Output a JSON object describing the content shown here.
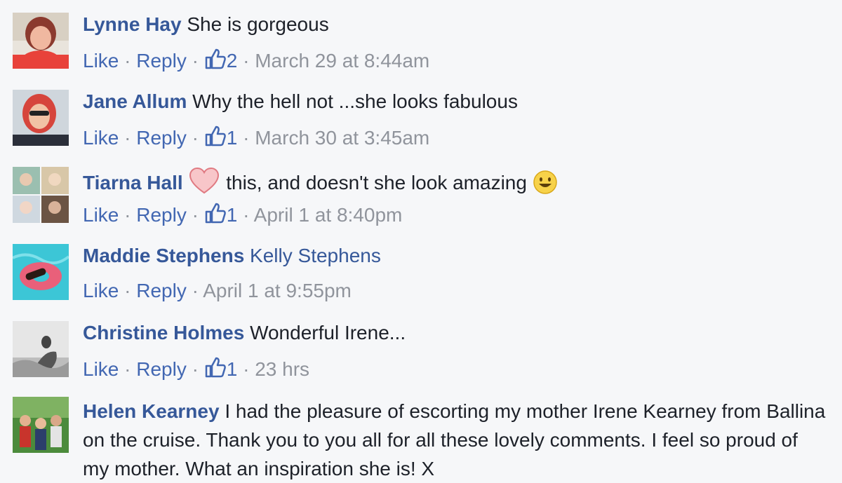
{
  "actions": {
    "like": "Like",
    "reply": "Reply",
    "dot": "·"
  },
  "comments": [
    {
      "name": "Lynne Hay",
      "text": "She is gorgeous",
      "likes": "2",
      "time": "March 29 at 8:44am",
      "avatar_icon": "avatar-photo"
    },
    {
      "name": "Jane Allum",
      "text": "Why the hell not ...she looks fabulous",
      "likes": "1",
      "time": "March 30 at 3:45am",
      "avatar_icon": "avatar-photo"
    },
    {
      "name": "Tiarna Hall",
      "text": "this, and doesn't she look amazing",
      "likes": "1",
      "time": "April 1 at 8:40pm",
      "avatar_icon": "avatar-collage",
      "emoji_before": "heart-icon",
      "emoji_after": "smile-emoji-icon"
    },
    {
      "name": "Maddie Stephens",
      "tagged": "Kelly Stephens",
      "time": "April 1 at 9:55pm",
      "avatar_icon": "avatar-photo"
    },
    {
      "name": "Christine Holmes",
      "text": "Wonderful Irene...",
      "likes": "1",
      "time": "23 hrs",
      "avatar_icon": "avatar-photo"
    },
    {
      "name": "Helen Kearney",
      "text": "I had the pleasure of escorting my mother Irene Kearney from Ballina on the cruise. Thank you to you all for all these lovely comments. I feel so proud of my mother. What an inspiration she is! X",
      "avatar_icon": "avatar-photo"
    }
  ],
  "colors": {
    "background": "#f6f7f9",
    "name": "#365899",
    "link": "#4267b2",
    "meta": "#90949c",
    "text": "#1d2129"
  }
}
